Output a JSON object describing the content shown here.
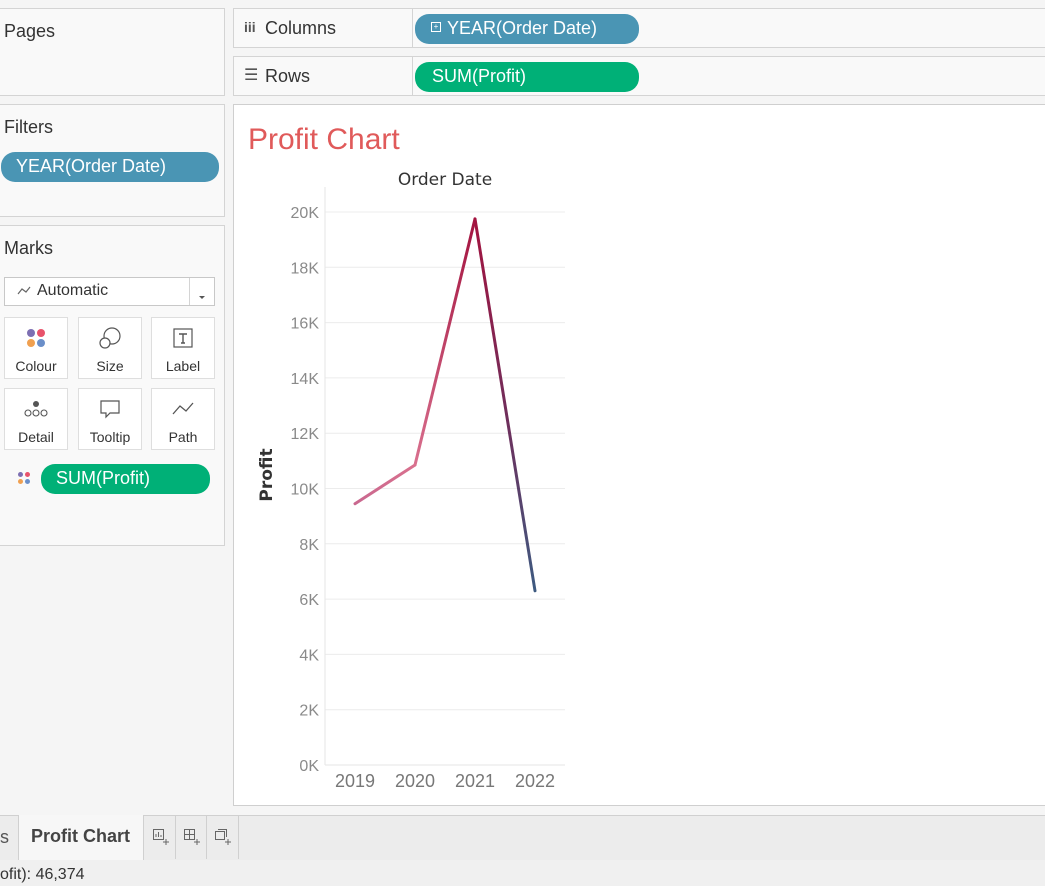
{
  "pages_panel": {
    "title": "Pages"
  },
  "shelves": {
    "columns": {
      "label": "Columns",
      "pill": "YEAR(Order Date)"
    },
    "rows": {
      "label": "Rows",
      "pill": "SUM(Profit)"
    }
  },
  "filters_panel": {
    "title": "Filters",
    "pill": "YEAR(Order Date)"
  },
  "marks_panel": {
    "title": "Marks",
    "mark_type": "Automatic",
    "cards": {
      "colour": "Colour",
      "size": "Size",
      "label": "Label",
      "detail": "Detail",
      "tooltip": "Tooltip",
      "path": "Path"
    },
    "colour_pill": "SUM(Profit)"
  },
  "sheet": {
    "title": "Profit Chart"
  },
  "chart_data": {
    "type": "line",
    "title": "Order Date",
    "xlabel": "Order Date",
    "ylabel": "Profit",
    "categories": [
      "2019",
      "2020",
      "2021",
      "2022"
    ],
    "series": [
      {
        "values": [
          9450,
          10850,
          19750,
          6300
        ]
      }
    ],
    "ylim": [
      0,
      20000
    ],
    "y_ticks": [
      "0K",
      "2K",
      "4K",
      "6K",
      "8K",
      "10K",
      "12K",
      "14K",
      "16K",
      "18K",
      "20K"
    ],
    "grid": true,
    "color_scale": "profit-gradient",
    "colors": {
      "low": "#3d5a80",
      "mid": "#d9708e",
      "high": "#a3133f"
    }
  },
  "tabs": {
    "prev_tab_fragment": "s",
    "active_tab": "Profit Chart"
  },
  "status": {
    "text": "ofit): 46,374"
  },
  "colors": {
    "blue_pill": "#4a95b4",
    "green_pill": "#00b077",
    "sheet_title": "#e05a5a"
  }
}
